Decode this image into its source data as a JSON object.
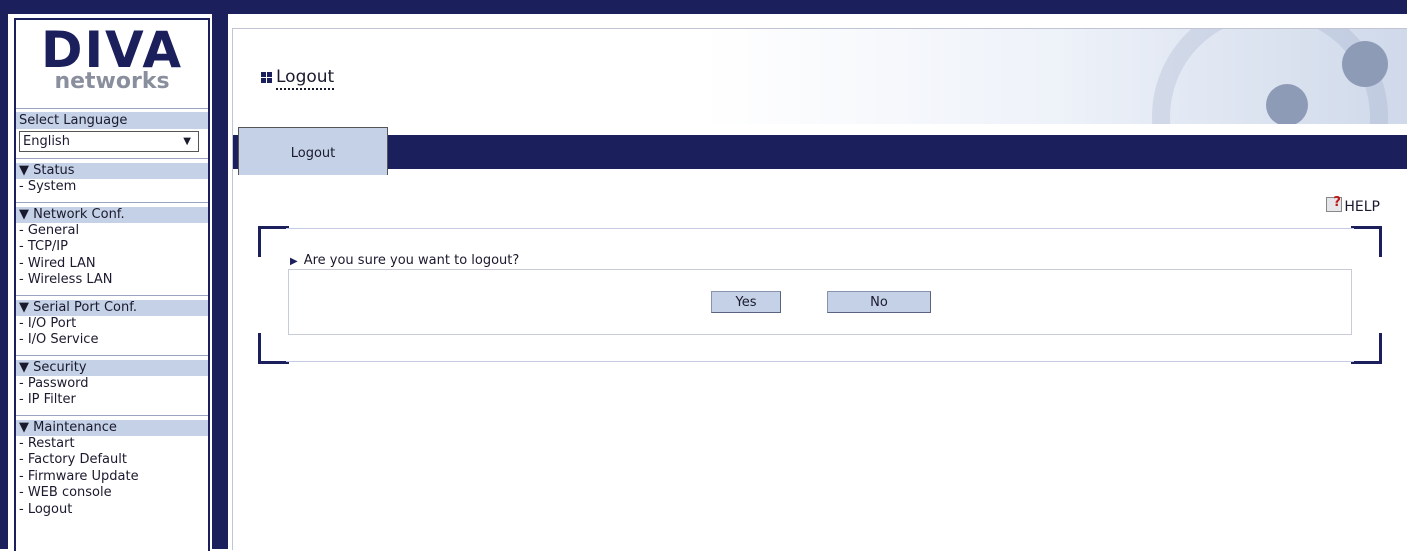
{
  "brand": {
    "line1": "DIVA",
    "line2": "networks"
  },
  "language": {
    "label": "Select Language",
    "selected": "English",
    "arrow": "▼"
  },
  "sidebar": {
    "sections": [
      {
        "title": "▼ Status",
        "items": [
          "- System"
        ]
      },
      {
        "title": "▼ Network Conf.",
        "items": [
          "- General",
          "- TCP/IP",
          "- Wired LAN",
          "- Wireless LAN"
        ]
      },
      {
        "title": "▼ Serial Port Conf.",
        "items": [
          "- I/O Port",
          "- I/O Service"
        ]
      },
      {
        "title": "▼ Security",
        "items": [
          "- Password",
          "- IP Filter"
        ]
      },
      {
        "title": "▼ Maintenance",
        "items": [
          "- Restart",
          "- Factory Default",
          "- Firmware Update",
          "- WEB console",
          "- Logout"
        ]
      }
    ]
  },
  "page": {
    "title": "Logout",
    "tab": "Logout",
    "help": "HELP"
  },
  "dialog": {
    "marker": "▶",
    "question": "Are you sure you want to logout?",
    "yes": "Yes",
    "no": "No"
  },
  "colors": {
    "navy": "#1b1f5c",
    "accent": "#c5d1e6"
  }
}
